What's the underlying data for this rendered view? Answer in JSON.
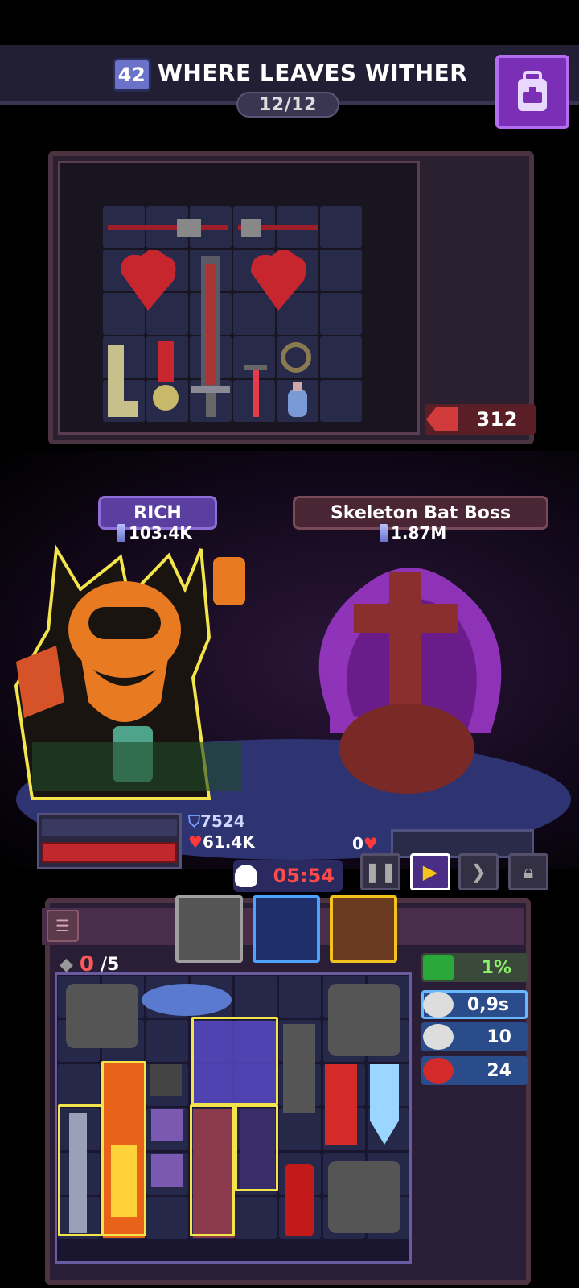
{
  "header": {
    "level": "42",
    "title": "WHERE LEAVES WITHER",
    "progress": "12/12",
    "backpack_icon": "backpack-icon"
  },
  "loot": {
    "gem_count": "312"
  },
  "player": {
    "name": "RICH",
    "power": "103.4K",
    "armor": "7524",
    "hp": "61.4K"
  },
  "boss": {
    "name": "Skeleton Bat Boss",
    "power": "1.87M",
    "hp": "0"
  },
  "battle": {
    "timer": "05:54",
    "controls": [
      "pause",
      "play",
      "fast-forward",
      "lock"
    ]
  },
  "inventory": {
    "slots_used": "0",
    "slots_max": "/5",
    "stats": [
      {
        "icon": "regen-icon",
        "value": "1%"
      },
      {
        "icon": "attack-speed-icon",
        "value": "0,9s"
      },
      {
        "icon": "crit-icon",
        "value": "10"
      },
      {
        "icon": "lifesteal-icon",
        "value": "24"
      }
    ]
  },
  "colors": {
    "accent_purple": "#7a2fb6",
    "hp_red": "#c2262e",
    "highlight_yellow": "#f2e44a",
    "timer_red": "#ff4a4a"
  }
}
